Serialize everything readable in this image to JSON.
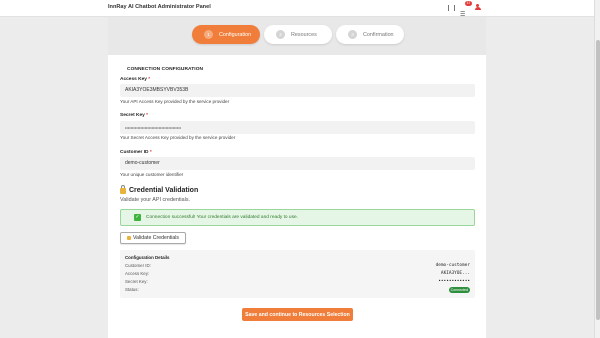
{
  "header": {
    "title": "InnRay AI Chatbot Administrator Panel",
    "notification_count": "37",
    "icons": [
      "inbox-icon",
      "user-icon"
    ]
  },
  "steps": [
    {
      "number": "1",
      "label": "Configuration",
      "active": true
    },
    {
      "number": "2",
      "label": "Resources",
      "active": false
    },
    {
      "number": "3",
      "label": "Confirmation",
      "active": false
    }
  ],
  "connection": {
    "section_title": "CONNECTION CONFIGURATION",
    "access_key": {
      "label": "Access Key",
      "required": "*",
      "value": "AKIA3YOE3MBSYVBV353B",
      "help": "Your API Access Key provided by the service provider"
    },
    "secret_key": {
      "label": "Secret Key",
      "required": "*",
      "value": "••••••••••••••••••••••••••••••••••••••••",
      "help": "Your Secret Access Key provided by the service provider"
    },
    "customer_id": {
      "label": "Customer ID",
      "required": "*",
      "value": "demo-customer",
      "help": "Your unique customer identifier"
    }
  },
  "validation": {
    "title": "Credential Validation",
    "subtitle": "Validate your API credentials.",
    "success_message": "Connection successful! Your credentials are validated and ready to use.",
    "validate_button": "Validate Credentials"
  },
  "details": {
    "title": "Configuration Details",
    "rows": [
      {
        "key": "Customer ID:",
        "value": "demo-customer"
      },
      {
        "key": "Access Key:",
        "value": "AKIA3YOE..."
      },
      {
        "key": "Secret Key:",
        "value": "••••••••••••"
      },
      {
        "key": "Status:",
        "value": "Connected"
      }
    ]
  },
  "save_button": "Save and continue to Resources Selection",
  "colors": {
    "accent": "#f07e3a",
    "success": "#2e8f3f",
    "required": "#d33333"
  }
}
